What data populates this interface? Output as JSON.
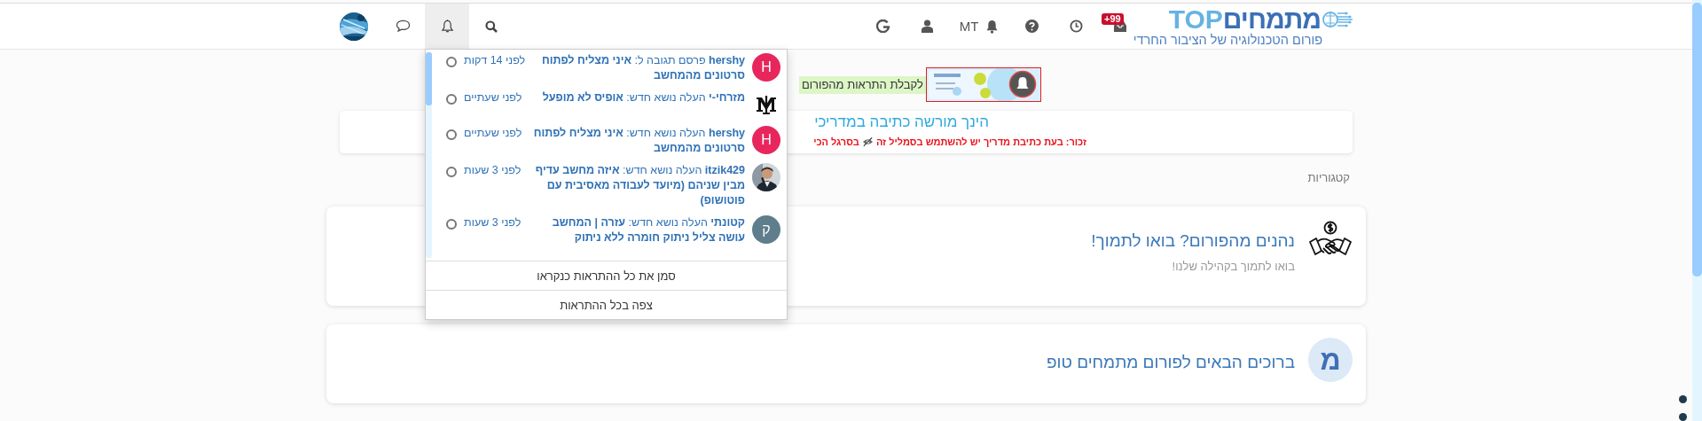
{
  "navbar": {
    "logo": {
      "wordmark": "מתמחים",
      "wordmark_latin": "TOP",
      "tagline": "פורום הטכנולוגיה של הציבור החרדי"
    },
    "items": [
      {
        "kind": "inbox",
        "badge": "+99"
      },
      {
        "kind": "clock"
      },
      {
        "kind": "help"
      },
      {
        "kind": "bell",
        "label": "MT"
      },
      {
        "kind": "user"
      },
      {
        "kind": "google"
      }
    ],
    "left_items": [
      {
        "kind": "search",
        "selected": false
      },
      {
        "kind": "notifications",
        "selected": true
      },
      {
        "kind": "chat",
        "selected": false
      },
      {
        "kind": "avatar",
        "selected": false
      }
    ]
  },
  "notifications": {
    "items": [
      {
        "avatar": {
          "kind": "letter",
          "text": "H",
          "color": "#e8265e"
        },
        "text": "**hershy** פרסם תגובה ל: **איני מצליח לפתוח סרטונים מהמחשב**",
        "time": "לפני 14 דקות",
        "read": false
      },
      {
        "avatar": {
          "kind": "logo"
        },
        "text": "**מזרחי-י** העלה נושא חדש: **אופיס לא מופעל**",
        "time": "לפני שעתיים",
        "read": false
      },
      {
        "avatar": {
          "kind": "letter",
          "text": "H",
          "color": "#e8265e"
        },
        "text": "**hershy** העלה נושא חדש: **איני מצליח לפתוח סרטונים מהמחשב**",
        "time": "לפני שעתיים",
        "read": false
      },
      {
        "text": "**itzik429** העלה נושא חדש: **איזה מחשב עדיף מבין שניהם (מיועד לעבודה מאסיבית עם פוטושופ)**",
        "time": "לפני 3 שעות",
        "read": false
      },
      {
        "avatar": {
          "kind": "letter",
          "text": "ק",
          "color": "#5f7d8c"
        },
        "text": "**קטונתי** העלה נושא חדש: **עזרה | המחשב עושה צליל ניתוק חומרה ללא ניתוק**",
        "time": "לפני 3 שעות",
        "read": false
      }
    ],
    "actions": [
      "סמן את כל ההתראות כנקראו",
      "צפה בכל ההתראות"
    ]
  },
  "subscribe_prompt": {
    "text": "לקבלת התראות מהפורום"
  },
  "notice": {
    "title": "הינך מורשה כתיבה במדריכי",
    "reminder_before": "זכור: בעת כתיבת מדריך יש להשתמש בסמליל זה",
    "reminder_after": "בסרגל הכי"
  },
  "breadcrumb": "קטגוריות",
  "categories": [
    {
      "icon": {
        "kind": "handshake"
      },
      "title": "נהנים מהפורום? בואו לתמוך!",
      "description": "בואו לתמוך בקהילה שלנו!"
    },
    {
      "icon": {
        "kind": "letter",
        "text": "מ"
      },
      "title": "ברוכים הבאים לפורום מתמחים טופ"
    }
  ]
}
